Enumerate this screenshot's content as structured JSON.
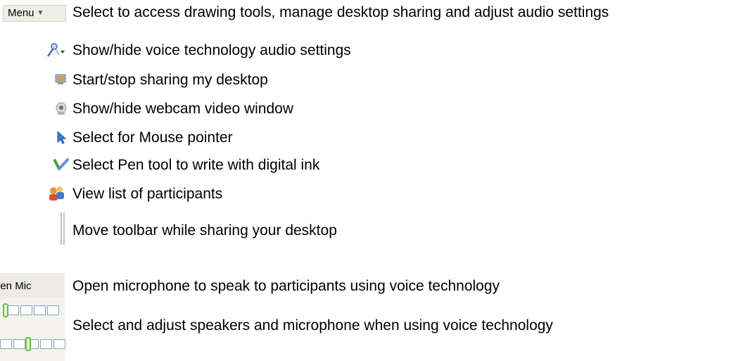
{
  "legend": {
    "menu_button": {
      "label": "Menu",
      "description": "Select to access drawing tools, manage desktop sharing and adjust audio settings",
      "icon": "menu-dropdown-icon"
    },
    "items": [
      {
        "key": "audio",
        "description": "Show/hide voice technology audio settings",
        "icon": "audio-settings-icon"
      },
      {
        "key": "share",
        "description": "Start/stop sharing my desktop",
        "icon": "desktop-share-icon"
      },
      {
        "key": "webcam",
        "description": "Show/hide webcam video window",
        "icon": "webcam-icon"
      },
      {
        "key": "pointer",
        "description": "Select for Mouse pointer",
        "icon": "mouse-pointer-icon"
      },
      {
        "key": "pen",
        "description": "Select Pen tool to write with digital ink",
        "icon": "pen-tool-icon"
      },
      {
        "key": "participants",
        "description": "View list of participants",
        "icon": "participants-icon"
      },
      {
        "key": "move",
        "description": "Move toolbar while sharing your desktop",
        "icon": "toolbar-grip-icon"
      }
    ],
    "open_mic": {
      "label": "pen Mic",
      "description": "Open microphone to speak to participants using voice technology"
    },
    "volume": {
      "description": "Select and adjust speakers and microphone when using voice technology",
      "icon": "volume-slider-icon"
    }
  }
}
